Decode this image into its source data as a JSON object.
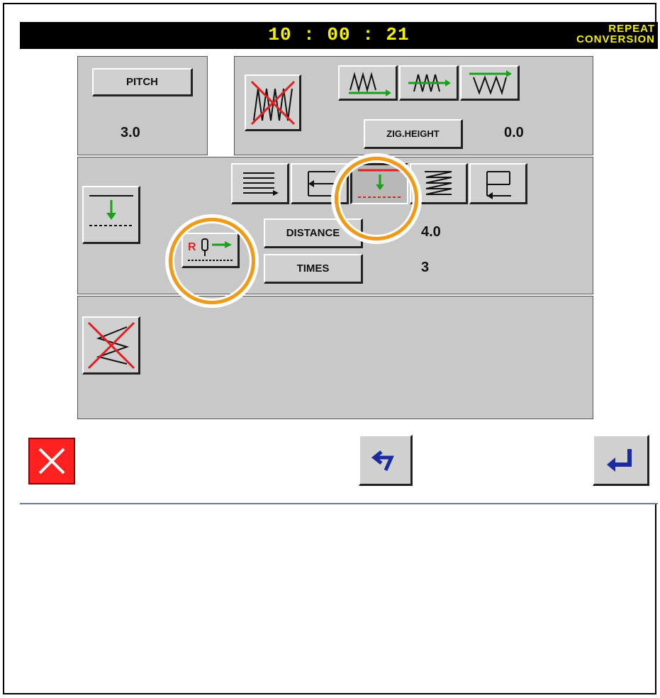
{
  "header": {
    "time": "10 : 00 : 21",
    "mode_line1": "REPEAT",
    "mode_line2": "CONVERSION"
  },
  "pitch": {
    "label": "PITCH",
    "value": "3.0"
  },
  "zig": {
    "button_label": "ZIG.HEIGHT",
    "value": "0.0",
    "pattern_icons": [
      "zigzag-disabled-icon",
      "zigzag-forward-icon",
      "zigzag-arrow-icon",
      "zigzag-wide-icon"
    ]
  },
  "repeat": {
    "pattern_icons": [
      "multi-forward-icon",
      "reverse-back-icon",
      "stitch-down-icon",
      "zigzag-stack-icon",
      "loop-return-icon"
    ],
    "selected_pattern": "stitch-down-icon",
    "distance_label": "DISTANCE",
    "distance_value": "4.0",
    "times_label": "TIMES",
    "times_value": "3"
  },
  "bottom_bar": {
    "cancel": "close-icon",
    "undo": "undo-icon",
    "enter": "enter-icon"
  },
  "colors": {
    "header_text": "#f5f000",
    "panel": "#c8c8c8",
    "highlight_ring": "#f09a1a",
    "cancel_bg": "#ff2020",
    "icon_blue": "#1a2aa0",
    "icon_green": "#1aa01a"
  }
}
